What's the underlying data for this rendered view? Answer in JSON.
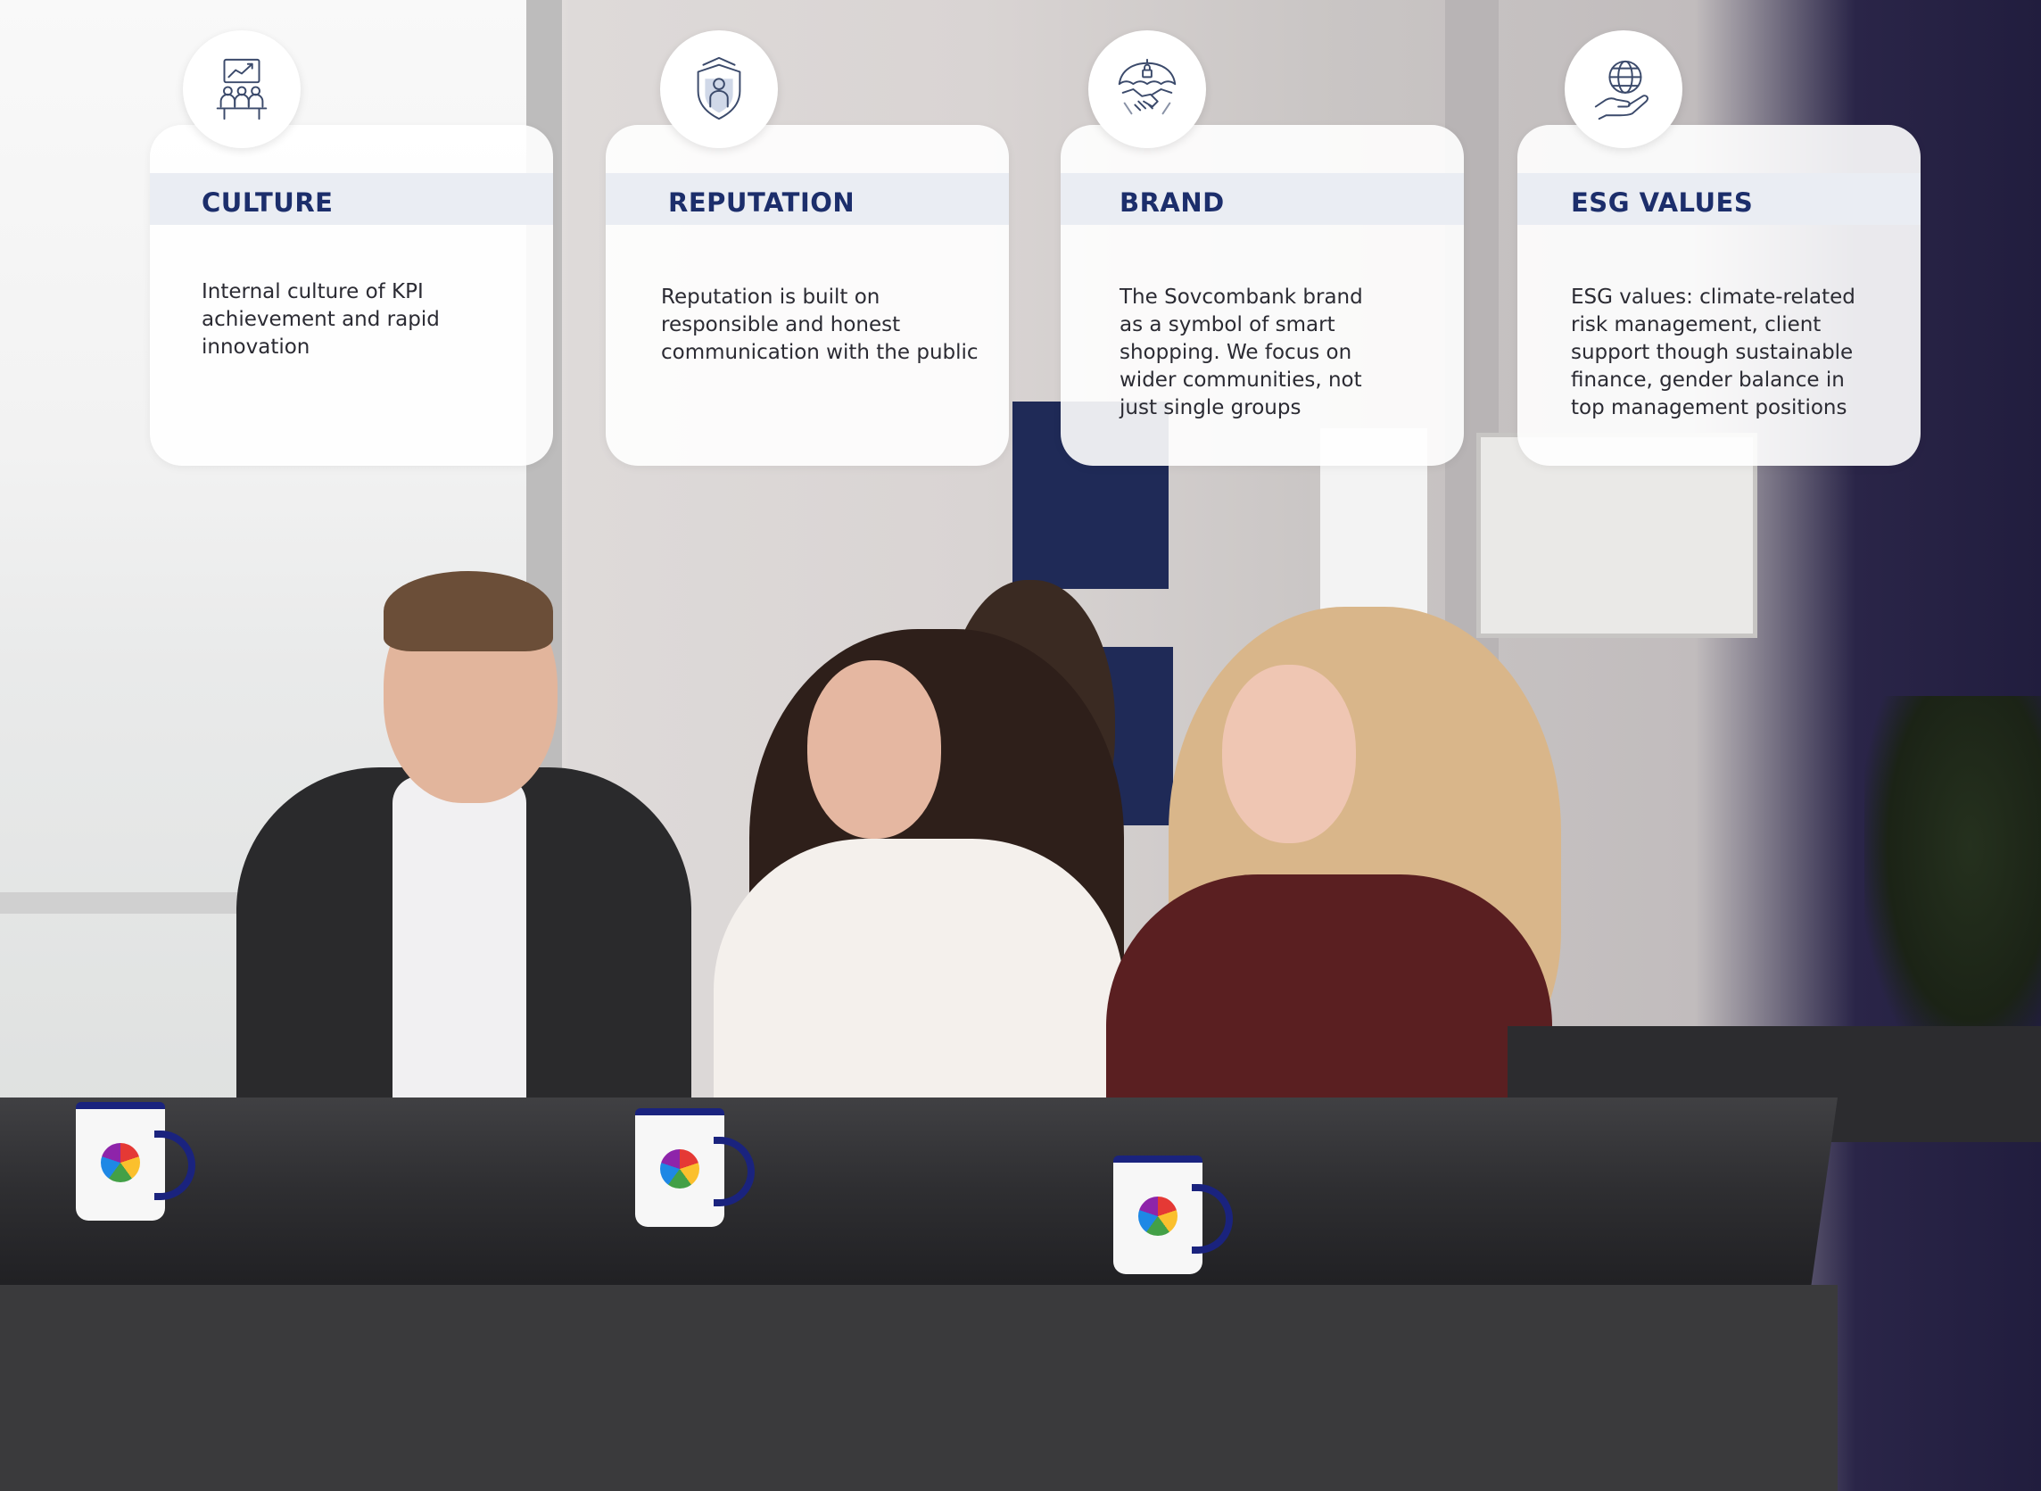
{
  "cards": [
    {
      "title": "CULTURE",
      "text": "Internal culture of KPI achievement and rapid innovation",
      "icon": "team-growth-icon"
    },
    {
      "title": "REPUTATION",
      "text": "Reputation is built on responsible and honest communication with the public",
      "icon": "shield-person-icon"
    },
    {
      "title": "BRAND",
      "text": "The Sovcombank brand as a symbol of smart shopping. We focus on wider communities, not just single groups",
      "icon": "umbrella-handshake-icon"
    },
    {
      "title": "ESG VALUES",
      "text": "ESG values: climate-related risk management, client support though sustainable finance, gender balance in top management positions",
      "icon": "globe-hand-icon"
    }
  ],
  "colors": {
    "title": "#1c2e6b",
    "band": "#eaedf3",
    "text": "#2b2b33",
    "icon_stroke": "#3b4a6b"
  }
}
